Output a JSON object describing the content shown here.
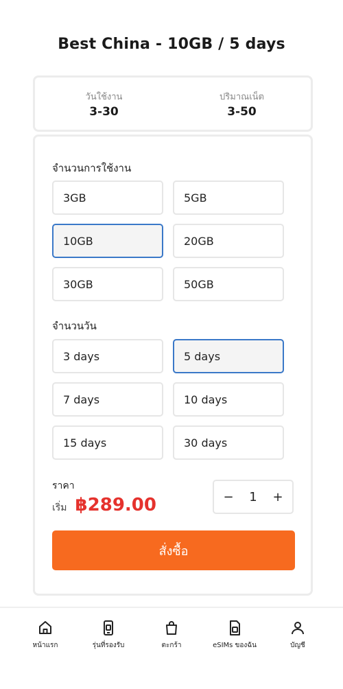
{
  "page": {
    "title": "Best China - 10GB / 5 days"
  },
  "summary": [
    {
      "label": "วันใช้งาน",
      "value": "3-30"
    },
    {
      "label": "ปริมาณเน็ต",
      "value": "3-50"
    }
  ],
  "data_section": {
    "label": "จำนวนการใช้งาน",
    "options": [
      "3GB",
      "5GB",
      "10GB",
      "20GB",
      "30GB",
      "50GB"
    ],
    "selected": "10GB"
  },
  "days_section": {
    "label": "จำนวนวัน",
    "options": [
      "3 days",
      "5 days",
      "7 days",
      "10 days",
      "15 days",
      "30 days"
    ],
    "selected": "5 days"
  },
  "price": {
    "label": "ราคา",
    "start_text": "เริ่ม",
    "amount": "฿289.00"
  },
  "quantity": {
    "minus": "−",
    "value": "1",
    "plus": "+"
  },
  "buy_button": {
    "label": "สั่งซื้อ"
  },
  "bottom_nav": [
    {
      "label": "หน้าแรก",
      "icon": "home-icon"
    },
    {
      "label": "รุ่นที่รองรับ",
      "icon": "phone-icon"
    },
    {
      "label": "ตะกร้า",
      "icon": "bag-icon"
    },
    {
      "label": "eSIMs ของฉัน",
      "icon": "esim-icon"
    },
    {
      "label": "บัญชี",
      "icon": "user-icon"
    }
  ],
  "colors": {
    "accent": "#f76a1f",
    "price": "#e5322d",
    "selected_border": "#3a78c8"
  }
}
